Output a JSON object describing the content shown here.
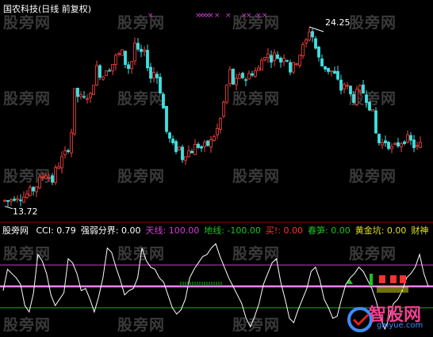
{
  "header": {
    "stock_name": "国农科技",
    "period_label": "(日线 前复权)"
  },
  "price_panel": {
    "high_label": "24.25",
    "low_label": "13.72"
  },
  "indicator_row": {
    "name": "股旁网",
    "items": [
      {
        "label": "CCI: 0.79",
        "color": "#ffffff"
      },
      {
        "label": "强弱分界: 0.00",
        "color": "#ffffff"
      },
      {
        "label": "天线: 100.00",
        "color": "#d040d0"
      },
      {
        "label": "地线: -100.00",
        "color": "#20c020"
      },
      {
        "label": "买!: 0.00",
        "color": "#ff3030"
      },
      {
        "label": "春笋: 0.00",
        "color": "#20c020"
      },
      {
        "label": "黄金坑: 0.00",
        "color": "#e0e020"
      },
      {
        "label": "财神",
        "color": "#e0e020"
      }
    ]
  },
  "watermarks": [
    "股旁网",
    "股旁网",
    "股旁网",
    "股旁网",
    "股旁网",
    "股旁网",
    "股旁网",
    "股旁网",
    "股旁网",
    "股旁网",
    "股旁网",
    "股旁网",
    "股旁网",
    "股旁网",
    "股旁网",
    "股旁网",
    "股旁网",
    "股旁网",
    "股旁网",
    "股旁网",
    "股旁网"
  ],
  "logo": {
    "text": "智股网",
    "url": "gaiyue.com"
  },
  "colors": {
    "up": "#ff4040",
    "down": "#40e0e0",
    "cci": "#ffffff",
    "sky": "#c040c0",
    "ground": "#20b020",
    "zero": "#ff80ff"
  },
  "chart_data": [
    {
      "type": "candlestick",
      "title": "国农科技",
      "series_high": 24.25,
      "series_low": 13.72,
      "ylim": [
        13.2,
        24.9
      ]
    },
    {
      "type": "line",
      "name": "CCI",
      "levels": {
        "天线": 100,
        "强弱分界": 0,
        "地线": -100
      },
      "last_value": 0.79,
      "ylim": [
        -230,
        230
      ]
    }
  ]
}
